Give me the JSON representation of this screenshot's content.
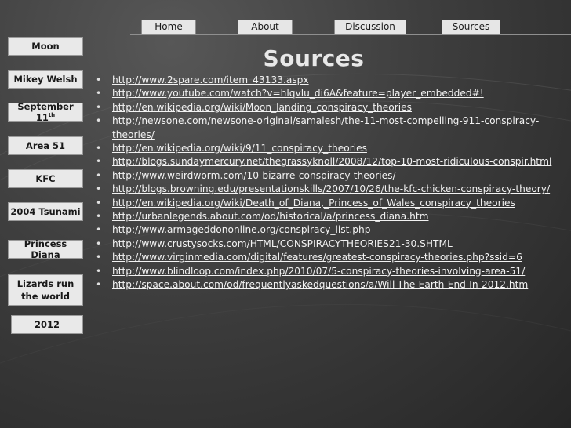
{
  "nav": {
    "tabs": [
      {
        "label": "Home"
      },
      {
        "label": "About"
      },
      {
        "label": "Discussion"
      },
      {
        "label": "Sources"
      }
    ]
  },
  "sidebar": {
    "items": [
      {
        "label": "Moon"
      },
      {
        "label": "Mikey Welsh"
      },
      {
        "label": "September 11",
        "sup": "th"
      },
      {
        "label": "Area 51"
      },
      {
        "label": "KFC"
      },
      {
        "label": "2004 Tsunami"
      },
      {
        "label": "Princess Diana"
      },
      {
        "label": "Lizards run the world"
      },
      {
        "label": "2012"
      }
    ]
  },
  "main": {
    "title": "Sources",
    "links": [
      "http://www.2spare.com/item_43133.aspx",
      "http://www.youtube.com/watch?v=hlqvlu_di6A&feature=player_embedded#!",
      "http://en.wikipedia.org/wiki/Moon_landing_conspiracy_theories",
      "http://newsone.com/newsone-original/samalesh/the-11-most-compelling-911-conspiracy-theories/",
      "http://en.wikipedia.org/wiki/9/11_conspiracy_theories",
      "http://blogs.sundaymercury.net/thegrassyknoll/2008/12/top-10-most-ridiculous-conspir.html",
      "http://www.weirdworm.com/10-bizarre-conspiracy-theories/",
      "http://blogs.browning.edu/presentationskills/2007/10/26/the-kfc-chicken-conspiracy-theory/",
      "http://en.wikipedia.org/wiki/Death_of_Diana,_Princess_of_Wales_conspiracy_theories",
      "http://urbanlegends.about.com/od/historical/a/princess_diana.htm",
      "http://www.armageddononline.org/conspiracy_list.php",
      "http://www.crustysocks.com/HTML/CONSPIRACYTHEORIES21-30.SHTML",
      "http://www.virginmedia.com/digital/features/greatest-conspiracy-theories.php?ssid=6",
      "http://www.blindloop.com/index.php/2010/07/5-conspiracy-theories-involving-area-51/",
      "http://space.about.com/od/frequentlyaskedquestions/a/Will-The-Earth-End-In-2012.htm"
    ]
  }
}
